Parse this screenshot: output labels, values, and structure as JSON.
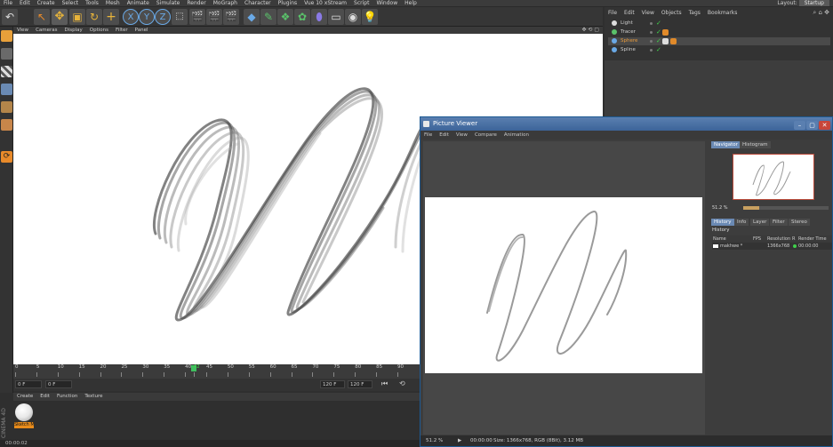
{
  "menubar": {
    "items": [
      "File",
      "Edit",
      "Create",
      "Select",
      "Tools",
      "Mesh",
      "Animate",
      "Simulate",
      "Render",
      "MoGraph",
      "Character",
      "Plugins",
      "Vue 10 xStream",
      "Script",
      "Window",
      "Help"
    ],
    "layout_label": "Layout:",
    "layout_value": "Startup"
  },
  "viewport": {
    "menu": [
      "View",
      "Cameras",
      "Display",
      "Options",
      "Filter",
      "Panel"
    ]
  },
  "timeline": {
    "ticks": [
      "0",
      "5",
      "10",
      "15",
      "20",
      "25",
      "30",
      "35",
      "40",
      "42",
      "45",
      "50",
      "55",
      "60",
      "65",
      "70",
      "75",
      "80",
      "85",
      "90"
    ],
    "current_frame": 42,
    "start_field": "0 F",
    "min_field": "0 F",
    "end_field": "120 F",
    "max_field": "120 F"
  },
  "material_manager": {
    "menu": [
      "Create",
      "Edit",
      "Function",
      "Texture"
    ],
    "material_name": "Sketch M"
  },
  "brand": "CINEMA 4D",
  "statusbar_text": "00:00:02",
  "object_manager": {
    "menu": [
      "File",
      "Edit",
      "View",
      "Objects",
      "Tags",
      "Bookmarks"
    ],
    "objects": [
      {
        "name": "Light",
        "color": "#cfcfcf"
      },
      {
        "name": "Tracer",
        "color": "#cfcfcf"
      },
      {
        "name": "Sphere",
        "color": "#e89a3a"
      },
      {
        "name": "Spline",
        "color": "#cfcfcf"
      }
    ]
  },
  "picture_viewer": {
    "title": "Picture Viewer",
    "menu": [
      "File",
      "Edit",
      "View",
      "Compare",
      "Animation"
    ],
    "side_tabs_top": [
      "Navigator",
      "Histogram"
    ],
    "zoom": "51.2 %",
    "side_tabs_bottom": [
      "History",
      "Info",
      "Layer",
      "Filter",
      "Stereo"
    ],
    "history_title": "History",
    "history_columns": [
      "Name",
      "FPS",
      "Resolution",
      "R",
      "Render Time"
    ],
    "history_row": {
      "name": "makhwe *",
      "fps": "",
      "resolution": "1366x768",
      "time": "00:00:00"
    },
    "status_zoom": "51.2 %",
    "status_time": "00:00:00",
    "status_info": "Size: 1366x768, RGB (8Bit), 3.12 MB"
  }
}
